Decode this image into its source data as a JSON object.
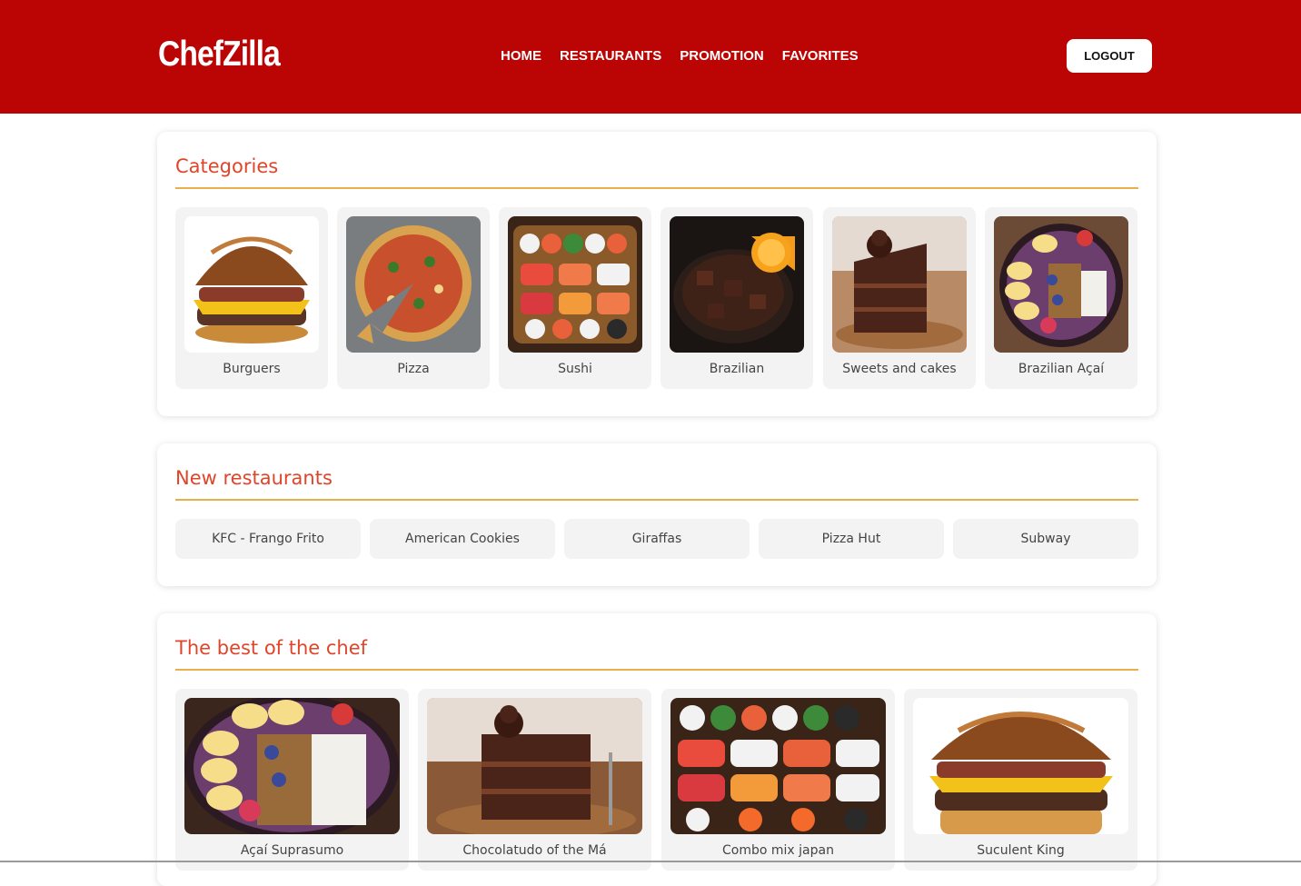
{
  "header": {
    "logo": "ChefZilla",
    "nav": [
      "HOME",
      "RESTAURANTS",
      "PROMOTION",
      "FAVORITES"
    ],
    "logout_label": "LOGOUT"
  },
  "colors": {
    "brand_red": "#bb0505",
    "section_title": "#e0452a",
    "rule": "#e8b04a"
  },
  "categories": {
    "title": "Categories",
    "items": [
      {
        "label": "Burguers",
        "icon": "burger-image"
      },
      {
        "label": "Pizza",
        "icon": "pizza-image"
      },
      {
        "label": "Sushi",
        "icon": "sushi-image"
      },
      {
        "label": "Brazilian",
        "icon": "stew-image"
      },
      {
        "label": "Sweets and cakes",
        "icon": "cake-image"
      },
      {
        "label": "Brazilian Açaí",
        "icon": "acai-bowl-image"
      }
    ]
  },
  "new_restaurants": {
    "title": "New restaurants",
    "items": [
      "KFC - Frango Frito",
      "American Cookies",
      "Giraffas",
      "Pizza Hut",
      "Subway"
    ]
  },
  "best_of_chef": {
    "title": "The best of the chef",
    "items": [
      {
        "label": "Açaí Suprasumo",
        "icon": "acai-bowl-image"
      },
      {
        "label": "Chocolatudo of the Má",
        "icon": "cake-image"
      },
      {
        "label": "Combo mix japan",
        "icon": "sushi-image"
      },
      {
        "label": "Suculent King",
        "icon": "burger-image"
      }
    ]
  }
}
